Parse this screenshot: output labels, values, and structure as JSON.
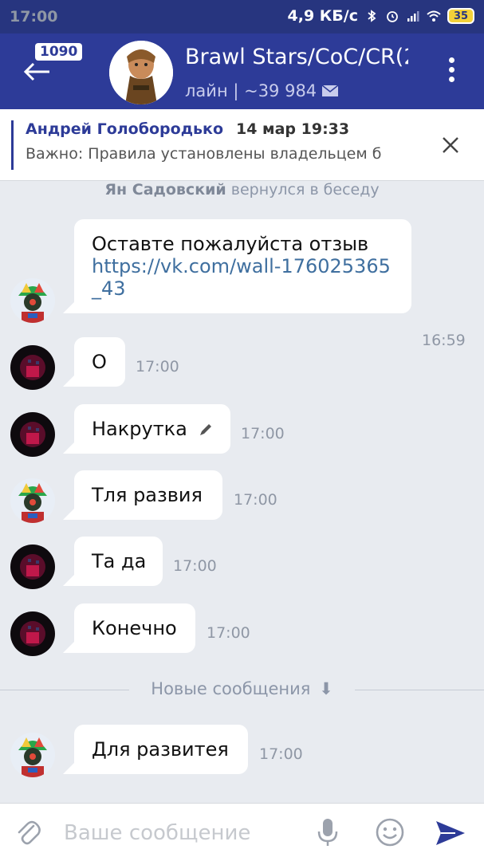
{
  "status_bar": {
    "time": "17:00",
    "network_speed": "4,9 КБ/с",
    "battery": "35",
    "icons": [
      "bluetooth-icon",
      "alarm-icon",
      "signal-icon",
      "wifi-icon",
      "battery-icon"
    ]
  },
  "header": {
    "unread_badge": "1090",
    "title": "Brawl Stars/CoC/CR(2",
    "subtitle": "лайн | ~39 984",
    "accent_color": "#2d3b98"
  },
  "pinned": {
    "author": "Андрей Голобородько",
    "date": "14 мар 19:33",
    "text": "Важно: Правила установлены владельцем б"
  },
  "chat": {
    "service_message": {
      "name": "Ян Садовский",
      "action": "вернулся в беседу"
    },
    "messages": [
      {
        "text": "Оставте пожалуйста отзыв",
        "link": "https://vk.com/wall-176025365_43",
        "time": "16:59",
        "avatar": "brawler-avatar"
      },
      {
        "text": "О",
        "time": "17:00",
        "avatar": "dark-avatar"
      },
      {
        "text": "Накрутка",
        "time": "17:00",
        "avatar": "dark-avatar",
        "edited": true
      },
      {
        "text": "Тля развия",
        "time": "17:00",
        "avatar": "brawler-avatar"
      },
      {
        "text": "Та да",
        "time": "17:00",
        "avatar": "dark-avatar"
      },
      {
        "text": "Конечно",
        "time": "17:00",
        "avatar": "dark-avatar"
      }
    ],
    "new_messages_label": "Новые сообщения",
    "new_messages": [
      {
        "text": "Для развитея",
        "time": "17:00",
        "avatar": "brawler-avatar"
      }
    ]
  },
  "composer": {
    "placeholder": "Ваше сообщение"
  },
  "colors": {
    "status_bar": "#27357f",
    "header": "#2d3b98",
    "link": "#3f6f9f",
    "background": "#e8ebf0"
  }
}
